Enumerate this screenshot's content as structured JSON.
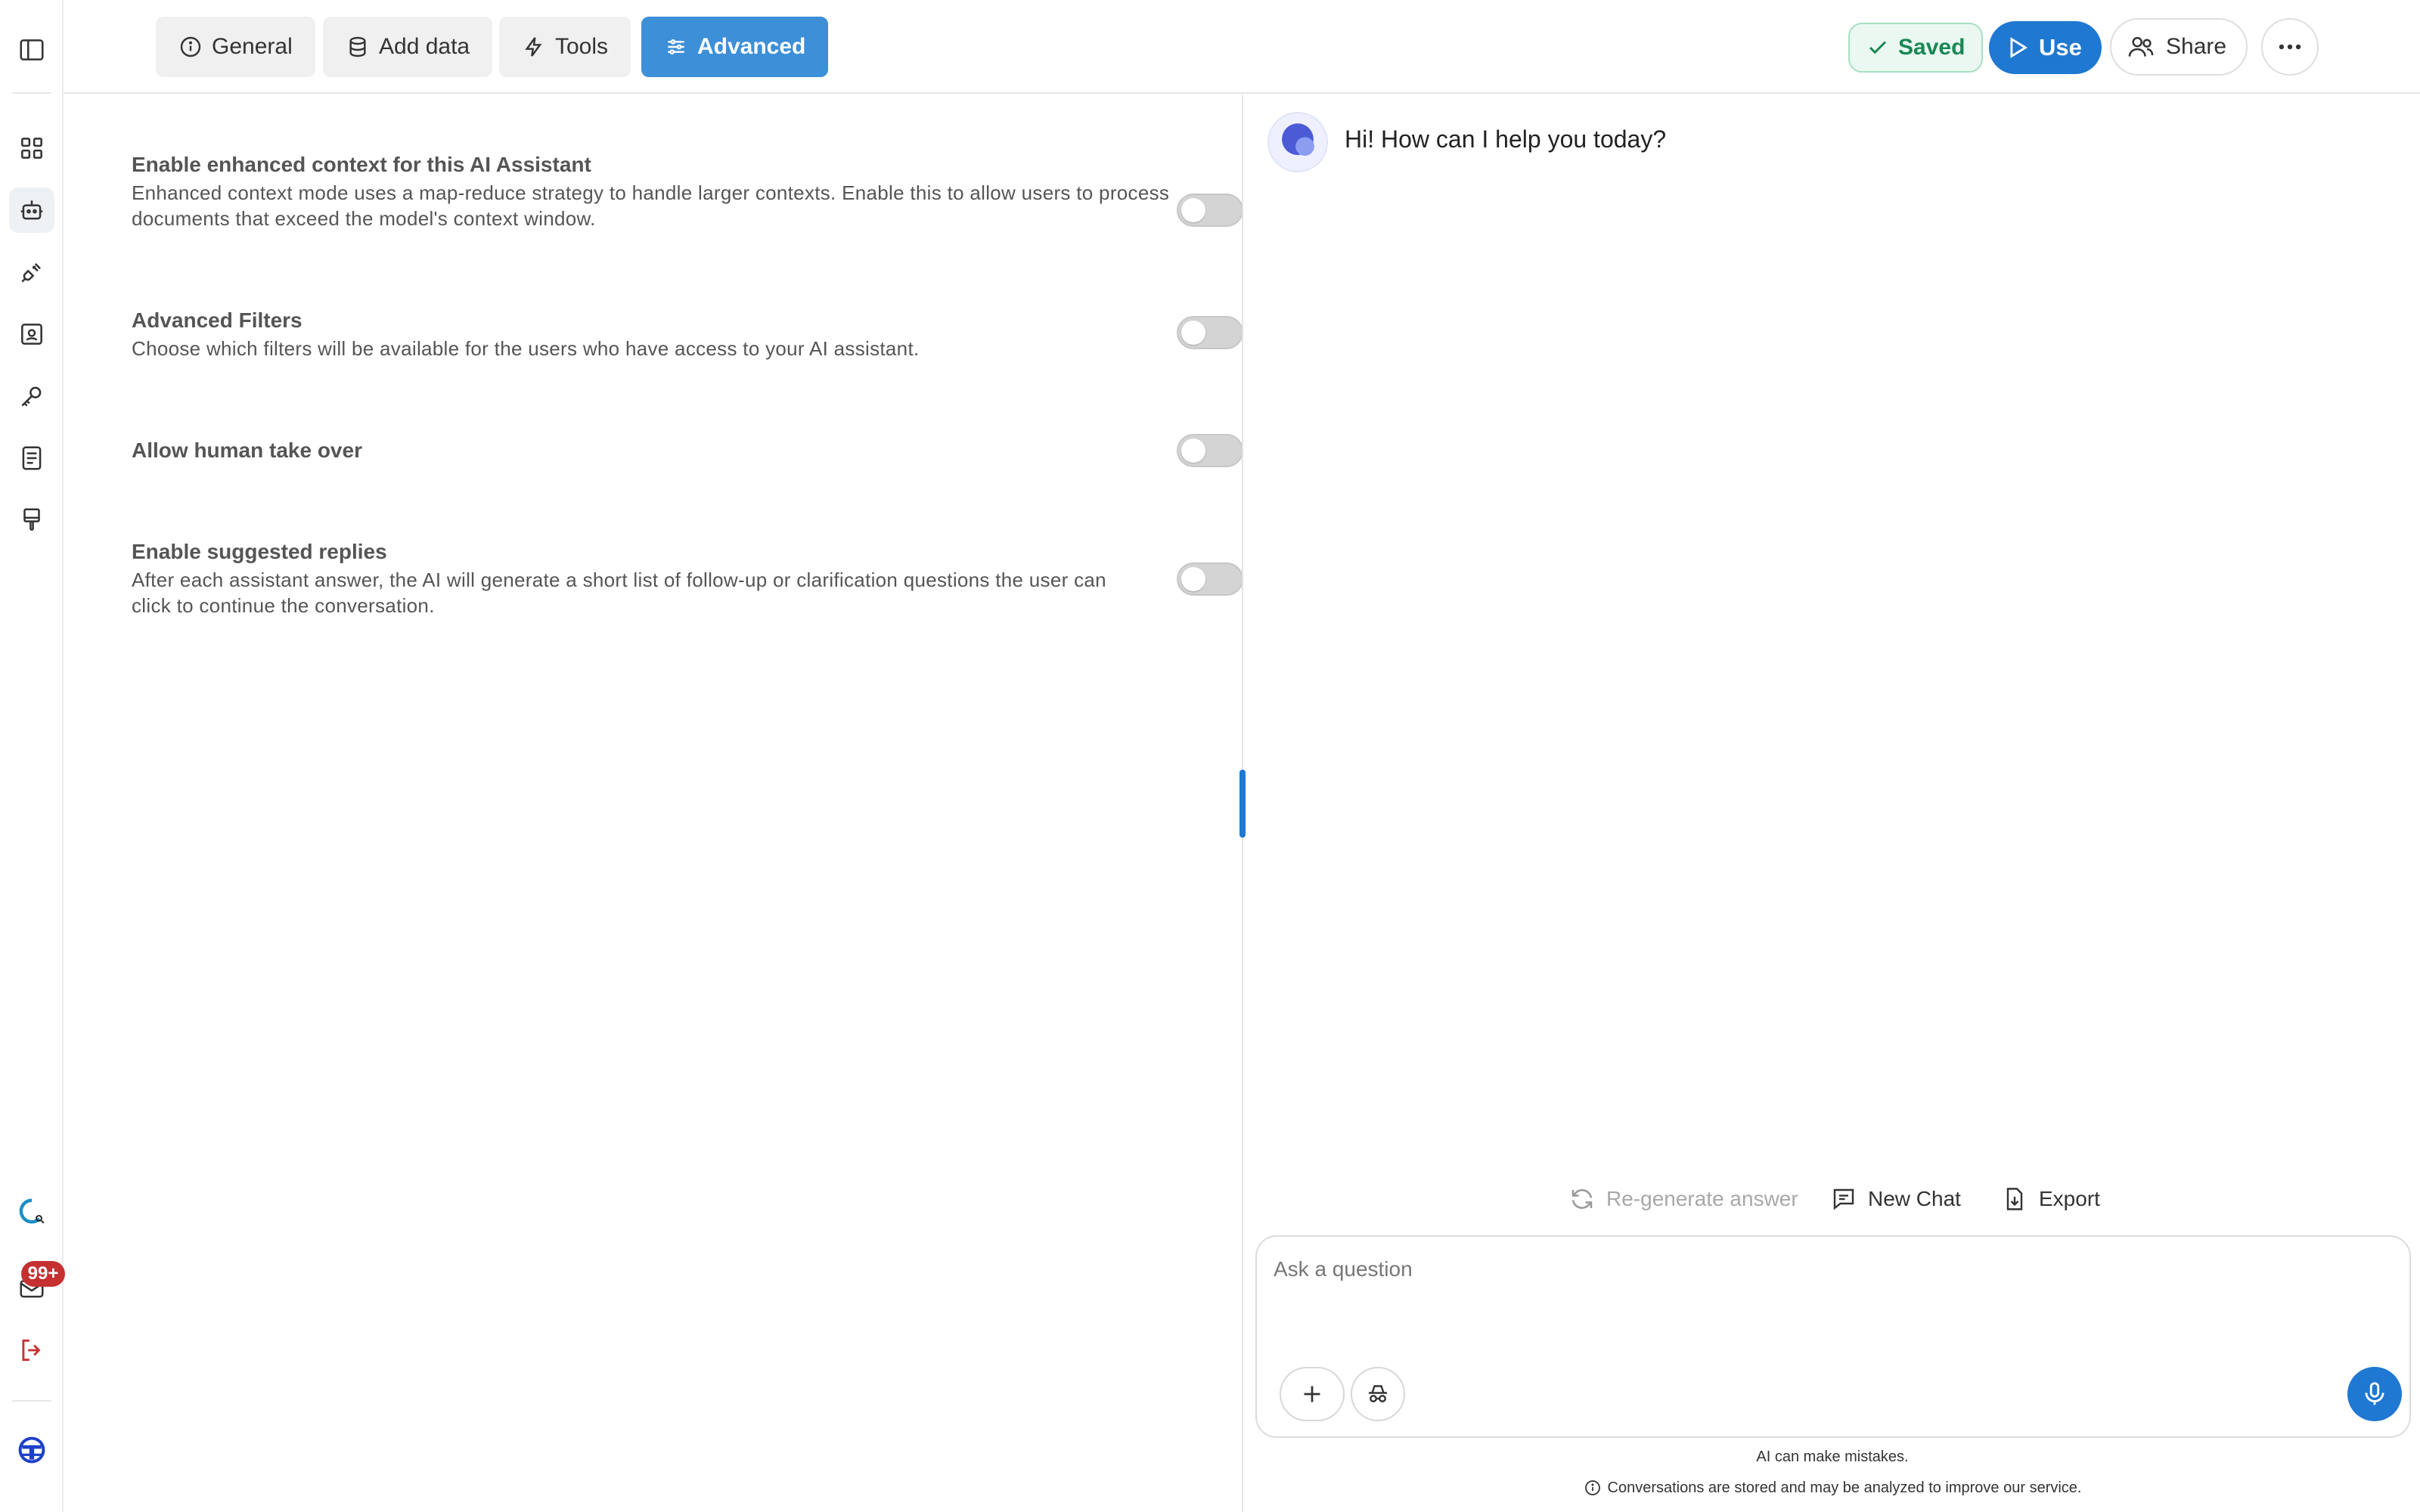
{
  "tabs": [
    {
      "label": "General",
      "icon": "info-icon"
    },
    {
      "label": "Add data",
      "icon": "database-icon"
    },
    {
      "label": "Tools",
      "icon": "bolt-icon"
    },
    {
      "label": "Advanced",
      "icon": "sliders-icon",
      "active": true
    }
  ],
  "header": {
    "saved_label": "Saved",
    "use_label": "Use",
    "share_label": "Share"
  },
  "sidebar": {
    "icons": [
      "sidebar-toggle-icon",
      "grid-icon",
      "robot-icon",
      "plug-icon",
      "scan-icon",
      "key-icon",
      "document-icon",
      "brush-icon",
      "assistant-logo-icon",
      "inbox-icon",
      "logout-icon",
      "user-avatar"
    ],
    "active": "robot-icon",
    "notification_count": "99+"
  },
  "settings": [
    {
      "title": "Enable enhanced context for this AI Assistant",
      "description": "Enhanced context mode uses a map-reduce strategy to handle larger contexts. Enable this to allow users to process documents that exceed the model's context window.",
      "enabled": false
    },
    {
      "title": "Advanced Filters",
      "description": "Choose which filters will be available for the users who have access to your AI assistant.",
      "enabled": false
    },
    {
      "title": "Allow human take over",
      "description": "",
      "enabled": false
    },
    {
      "title": "Enable suggested replies",
      "description": "After each assistant answer, the AI will generate a short list of follow-up or clarification questions the user can click to continue the conversation.",
      "enabled": false
    }
  ],
  "chat": {
    "greeting": "Hi! How can I help you today?",
    "regenerate_label": "Re-generate answer",
    "new_chat_label": "New Chat",
    "export_label": "Export",
    "input_placeholder": "Ask a question",
    "disclaimer": "AI can make mistakes.",
    "storage_notice": "Conversations are stored and may be analyzed to improve our service."
  },
  "colors": {
    "accent": "#1f78d1",
    "tab_active": "#3d8fd8",
    "saved_green": "#198754",
    "badge_red": "#c53030"
  }
}
